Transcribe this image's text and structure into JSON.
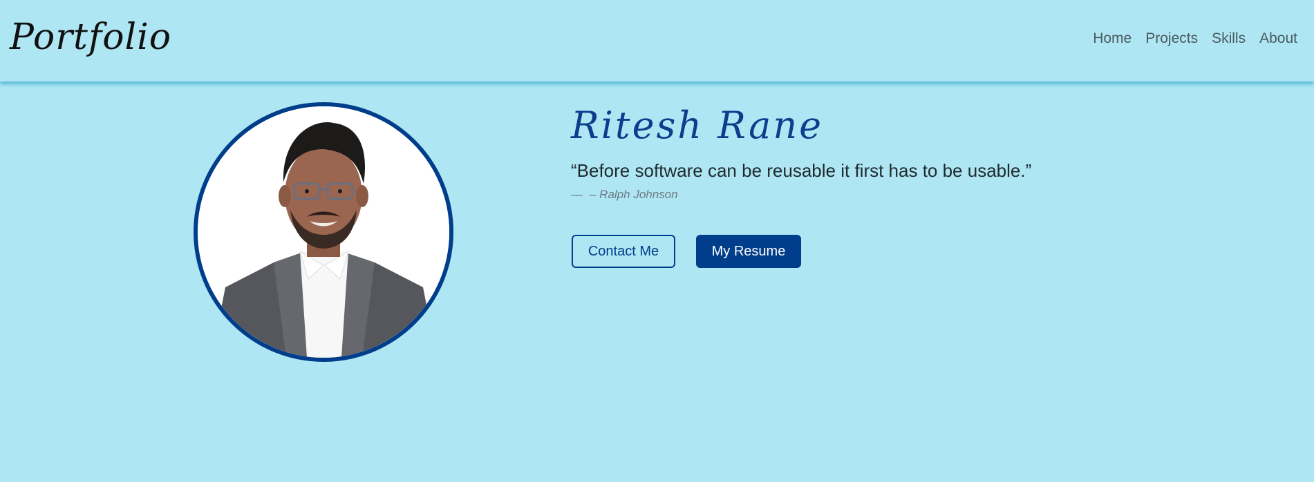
{
  "navbar": {
    "brand": "Portfolio",
    "links": [
      "Home",
      "Projects",
      "Skills",
      "About"
    ]
  },
  "hero": {
    "name": "Ritesh Rane",
    "quote": "“Before software can be reusable it first has to be usable.”",
    "quote_dash": "—",
    "quote_author": "– Ralph Johnson",
    "buttons": {
      "contact": "Contact Me",
      "resume": "My Resume"
    }
  },
  "colors": {
    "background": "#aee6f3",
    "primary": "#003d8a",
    "name_color": "#0b3e8c"
  }
}
